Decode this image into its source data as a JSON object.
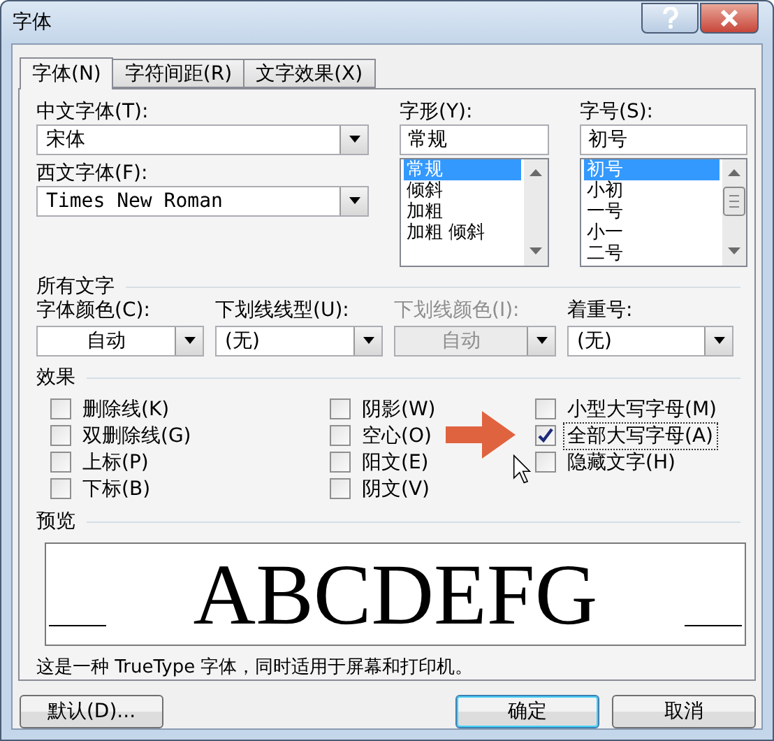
{
  "window": {
    "title": "字体"
  },
  "tabs": [
    {
      "label": "字体(N)",
      "selected": true
    },
    {
      "label": "字符间距(R)",
      "selected": false
    },
    {
      "label": "文字效果(X)",
      "selected": false
    }
  ],
  "chinese_font": {
    "label": "中文字体(T):",
    "value": "宋体"
  },
  "western_font": {
    "label": "西文字体(F):",
    "value": "Times New Roman"
  },
  "style": {
    "label": "字形(Y):",
    "value": "常规",
    "options": [
      {
        "label": "常规",
        "selected": true
      },
      {
        "label": "倾斜",
        "selected": false
      },
      {
        "label": "加粗",
        "selected": false
      },
      {
        "label": "加粗 倾斜",
        "selected": false
      }
    ]
  },
  "size": {
    "label": "字号(S):",
    "value": "初号",
    "options": [
      {
        "label": "初号",
        "selected": true
      },
      {
        "label": "小初",
        "selected": false
      },
      {
        "label": "一号",
        "selected": false
      },
      {
        "label": "小一",
        "selected": false
      },
      {
        "label": "二号",
        "selected": false
      }
    ]
  },
  "all_text": {
    "heading": "所有文字",
    "fields": [
      {
        "label": "字体颜色(C):",
        "value": "自动",
        "disabled": false,
        "centered": true
      },
      {
        "label": "下划线线型(U):",
        "value": "(无)",
        "disabled": false,
        "centered": false
      },
      {
        "label": "下划线颜色(I):",
        "value": "自动",
        "disabled": true,
        "centered": true
      },
      {
        "label": "着重号:",
        "value": "(无)",
        "disabled": false,
        "centered": false
      }
    ]
  },
  "effects": {
    "heading": "效果",
    "columns": [
      [
        {
          "label": "删除线(K)",
          "checked": false,
          "focused": false
        },
        {
          "label": "双删除线(G)",
          "checked": false,
          "focused": false
        },
        {
          "label": "上标(P)",
          "checked": false,
          "focused": false
        },
        {
          "label": "下标(B)",
          "checked": false,
          "focused": false
        }
      ],
      [
        {
          "label": "阴影(W)",
          "checked": false,
          "focused": false
        },
        {
          "label": "空心(O)",
          "checked": false,
          "focused": false
        },
        {
          "label": "阳文(E)",
          "checked": false,
          "focused": false
        },
        {
          "label": "阴文(V)",
          "checked": false,
          "focused": false
        }
      ],
      [
        {
          "label": "小型大写字母(M)",
          "checked": false,
          "focused": false
        },
        {
          "label": "全部大写字母(A)",
          "checked": true,
          "focused": true
        },
        {
          "label": "隐藏文字(H)",
          "checked": false,
          "focused": false
        }
      ]
    ]
  },
  "preview": {
    "heading": "预览",
    "sample": "ABCDEFG",
    "note": "这是一种 TrueType 字体，同时适用于屏幕和打印机。"
  },
  "buttons": [
    {
      "label": "默认(D)...",
      "kind": "left",
      "default": false
    },
    {
      "label": "确定",
      "kind": "right",
      "default": true
    },
    {
      "label": "取消",
      "kind": "right",
      "default": false
    }
  ]
}
